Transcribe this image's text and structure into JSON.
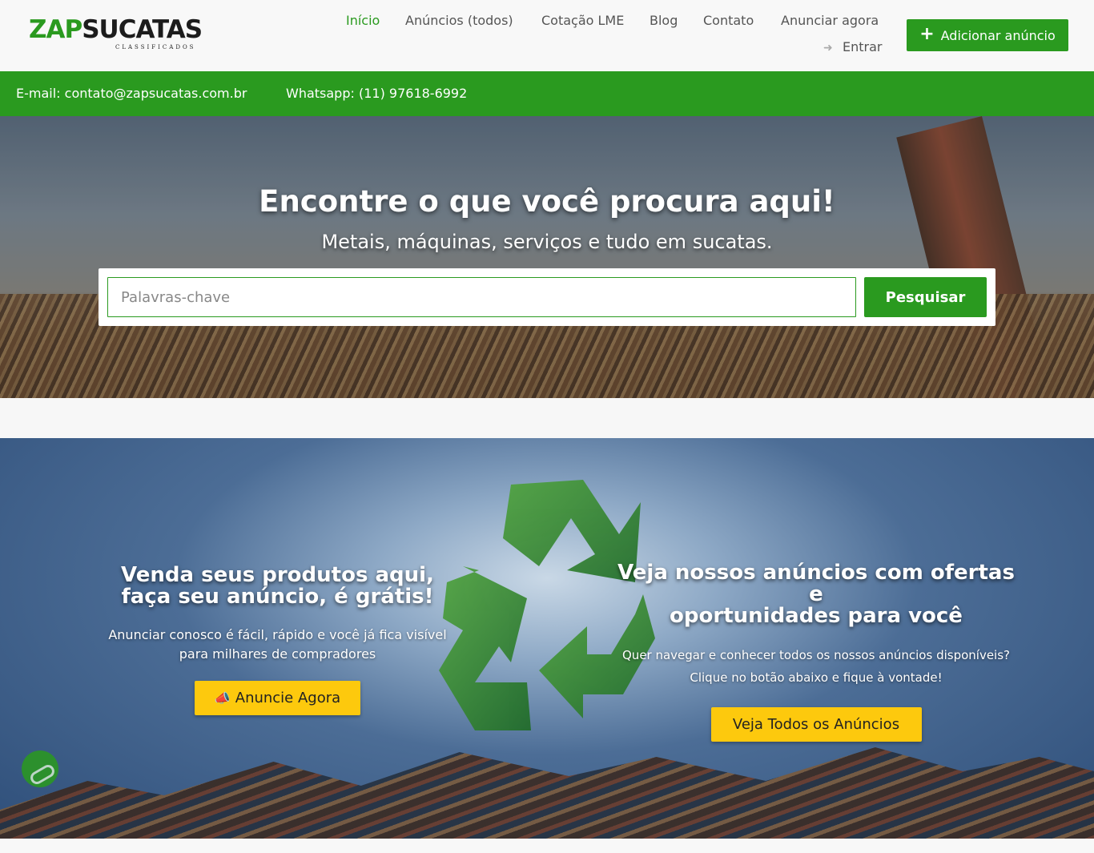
{
  "header": {
    "logo_primary": "ZAP",
    "logo_secondary": "SUCATAS",
    "logo_tagline": "CLASSIFICADOS",
    "nav": [
      {
        "label": "Início"
      },
      {
        "label": "Anúncios (todos)"
      },
      {
        "label": "Cotação LME"
      },
      {
        "label": "Blog"
      },
      {
        "label": "Contato"
      },
      {
        "label": "Anunciar agora"
      }
    ],
    "login_label": "Entrar",
    "add_button_label": "Adicionar anúncio"
  },
  "contact": {
    "email": "E-mail: contato@zapsucatas.com.br",
    "whatsapp": "Whatsapp: (11) 97618-6992"
  },
  "hero": {
    "title": "Encontre o que você procura aqui!",
    "subtitle": "Metais, máquinas, serviços e tudo em sucatas.",
    "search_placeholder": "Palavras-chave",
    "search_button": "Pesquisar"
  },
  "promo": {
    "left": {
      "title_line1": "Venda seus produtos aqui,",
      "title_line2": "faça seu anúncio, é grátis!",
      "text_line1": "Anunciar conosco é fácil, rápido e você já fica visível",
      "text_line2": "para milhares de compradores",
      "button": "Anuncie Agora"
    },
    "right": {
      "title_line1": "Veja nossos anúncios com ofertas e",
      "title_line2": "oportunidades para você",
      "text_line1": "Quer navegar e conhecer todos os nossos anúncios disponíveis?",
      "text_line2": "Clique no botão abaixo e fique à vontade!",
      "button": "Veja Todos os Anúncios"
    }
  },
  "colors": {
    "brand_green": "#2a9a1f",
    "accent_yellow": "#fdc90d"
  },
  "icons": {
    "add": "plus-icon",
    "login": "sign-in-icon",
    "announce": "megaphone-icon",
    "recycle": "recycle-icon"
  }
}
